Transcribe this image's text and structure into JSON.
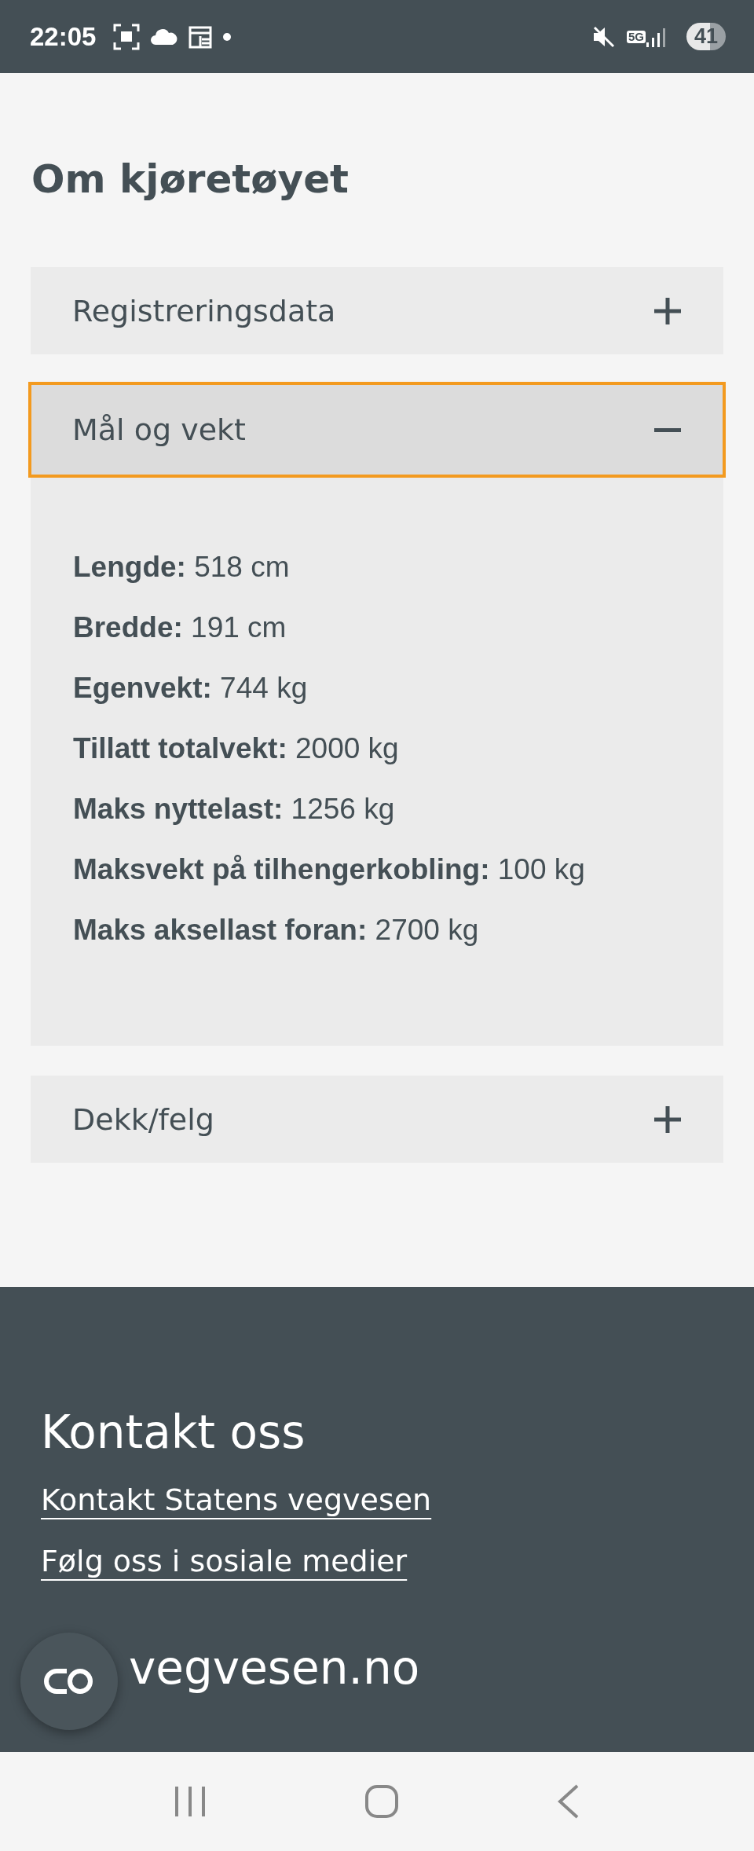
{
  "status_bar": {
    "time": "22:05",
    "network": "5G",
    "battery": "41"
  },
  "title": "Om kjøretøyet",
  "sections": [
    {
      "label": "Registreringsdata",
      "expanded": false,
      "focused": false
    },
    {
      "label": "Mål og vekt",
      "expanded": true,
      "focused": true,
      "rows": [
        "**Lengde:** 518 cm",
        "**Bredde:** 191 cm",
        "**Egenvekt:** 744 kg",
        "**Tillatt totalvekt:** 2000 kg",
        "**Maks nyttelast:** 1256 kg",
        "**Maksvekt på tilhengerkobling:** 100 kg",
        "**Maks aksellast foran:** 2700 kg"
      ]
    },
    {
      "label": "Dekk/felg",
      "expanded": false,
      "focused": false
    }
  ],
  "footer": {
    "heading": "Kontakt oss",
    "links": [
      "Kontakt Statens vegvesen",
      "Følg oss i sosiale medier"
    ],
    "heading_2": "vegvesen.no"
  }
}
